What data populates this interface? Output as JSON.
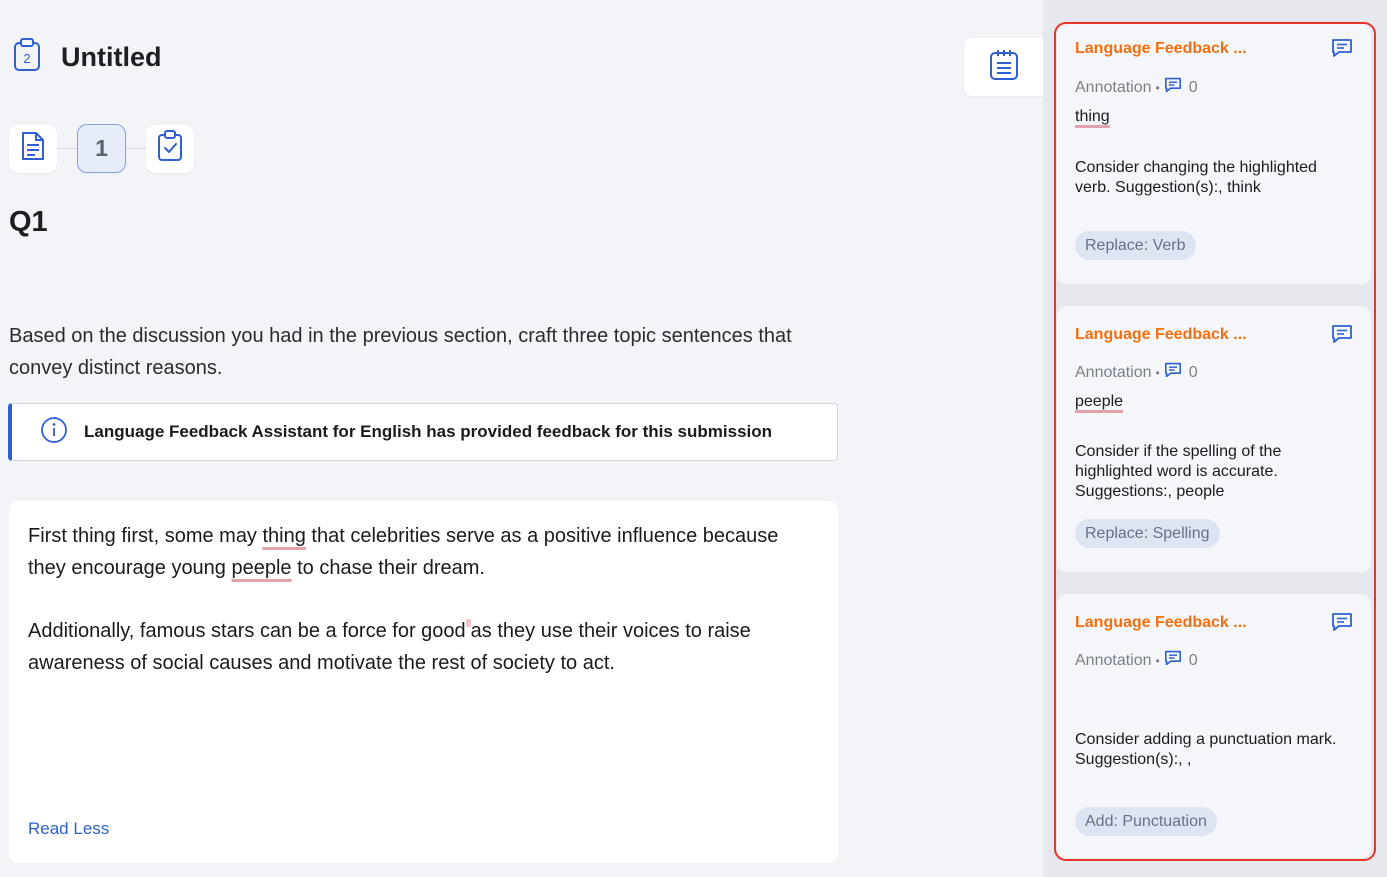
{
  "header": {
    "title": "Untitled",
    "doc_icon_number": "2"
  },
  "steps": {
    "active_label": "1"
  },
  "question": {
    "title": "Q1",
    "prompt": "Based on the discussion you had in the previous section, craft three topic sentences that convey distinct reasons."
  },
  "info_banner": {
    "text": "Language Feedback Assistant for English has provided feedback for this submission"
  },
  "answer": {
    "p1_a": "First thing first, some may ",
    "p1_hl1": "thing",
    "p1_b": " that celebrities serve as a positive influence because they encourage young ",
    "p1_hl2": "peeple",
    "p1_c": " to chase their dream.",
    "p2_a": "Additionally, famous stars can be a force for good",
    "p2_b": "as they use their voices to raise awareness of social causes and motivate the rest of society to act.",
    "read_less": "Read Less"
  },
  "cards": [
    {
      "title": "Language Feedback ...",
      "meta_label": "Annotation",
      "count": "0",
      "word": "thing",
      "description": "Consider changing the highlighted verb. Suggestion(s):, think",
      "tag": "Replace: Verb"
    },
    {
      "title": "Language Feedback ...",
      "meta_label": "Annotation",
      "count": "0",
      "word": "peeple",
      "description": "Consider if the spelling of the highlighted word is accurate. Suggestions:, people",
      "tag": "Replace: Spelling"
    },
    {
      "title": "Language Feedback ...",
      "meta_label": "Annotation",
      "count": "0",
      "word": "",
      "description": "Consider adding a punctuation mark. Suggestion(s):, ,",
      "tag": "Add: Punctuation"
    }
  ],
  "colors": {
    "accent": "#f07010",
    "link": "#2f5fd0",
    "selection": "#e8342c"
  }
}
